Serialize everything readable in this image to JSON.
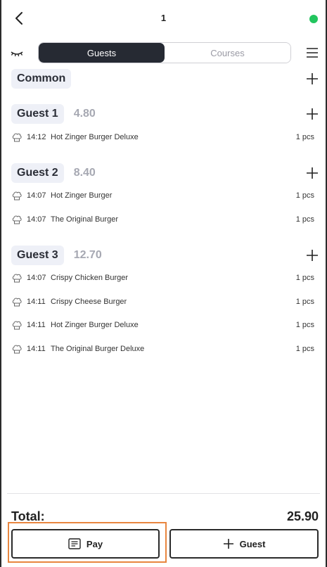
{
  "header": {
    "table_number": "1",
    "status_color": "#22c55e"
  },
  "tabs": [
    {
      "label": "Guests",
      "active": true
    },
    {
      "label": "Courses",
      "active": false
    }
  ],
  "groups": [
    {
      "label": "Common",
      "sum": "",
      "items": []
    },
    {
      "label": "Guest 1",
      "sum": "4.80",
      "items": [
        {
          "time": "14:12",
          "name": "Hot Zinger Burger Deluxe",
          "qty": "1 pcs"
        }
      ]
    },
    {
      "label": "Guest 2",
      "sum": "8.40",
      "items": [
        {
          "time": "14:07",
          "name": "Hot Zinger Burger",
          "qty": "1 pcs"
        },
        {
          "time": "14:07",
          "name": "The Original Burger",
          "qty": "1 pcs"
        }
      ]
    },
    {
      "label": "Guest 3",
      "sum": "12.70",
      "items": [
        {
          "time": "14:07",
          "name": "Crispy Chicken Burger",
          "qty": "1 pcs"
        },
        {
          "time": "14:11",
          "name": "Crispy Cheese Burger",
          "qty": "1 pcs"
        },
        {
          "time": "14:11",
          "name": "Hot Zinger Burger Deluxe",
          "qty": "1 pcs"
        },
        {
          "time": "14:11",
          "name": "The Original Burger Deluxe",
          "qty": "1 pcs"
        }
      ]
    }
  ],
  "total": {
    "label": "Total:",
    "value": "25.90"
  },
  "actions": {
    "pay_label": "Pay",
    "guest_label": "Guest"
  },
  "icons": {
    "back": "chevron-left-icon",
    "eye": "eye-closed-icon",
    "menu": "hamburger-menu-icon",
    "plus": "plus-icon",
    "chef": "chef-hat-icon",
    "receipt": "receipt-icon"
  },
  "colors": {
    "active_tab": "#262a33",
    "highlight": "#e8863f",
    "chip_bg": "#eef0f7",
    "sum_text": "#a6a8b2"
  }
}
